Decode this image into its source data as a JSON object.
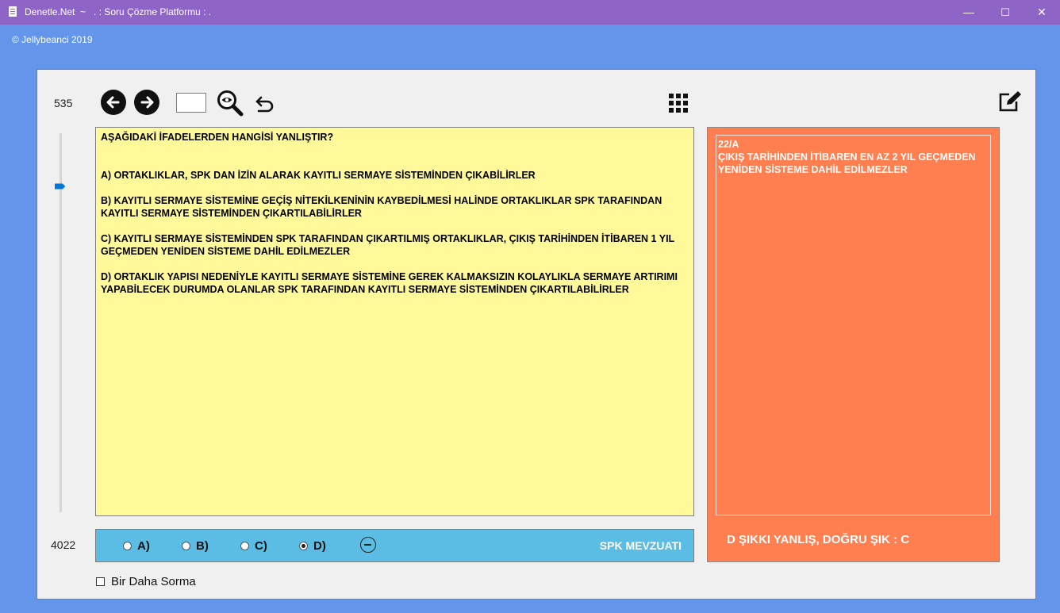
{
  "window": {
    "title": "Denetle.Net  ~   . : Soru Çözme Platformu : .",
    "minimize": "—",
    "maximize": "☐",
    "close": "✕"
  },
  "copyright": "© Jellybeanci 2019",
  "toolbar": {
    "current_number": "535",
    "total_number": "4022",
    "page_input_value": "",
    "icons": [
      "back-arrow-icon",
      "forward-arrow-icon",
      "search-icon",
      "undo-icon",
      "grid-icon",
      "edit-icon"
    ]
  },
  "question": {
    "text": "AŞAĞIDAKİ İFADELERDEN HANGİSİ YANLIŞTIR?",
    "options": {
      "a": "A) ORTAKLIKLAR, SPK DAN İZİN ALARAK KAYITLI SERMAYE SİSTEMİNDEN ÇIKABİLİRLER",
      "b": "B) KAYITLI SERMAYE SİSTEMİNE GEÇİŞ NİTEKİLKENİNİN KAYBEDİLMESİ HALİNDE ORTAKLIKLAR SPK TARAFINDAN KAYITLI SERMAYE SİSTEMİNDEN ÇIKARTILABİLİRLER",
      "c": "C) KAYITLI SERMAYE SİSTEMİNDEN SPK TARAFINDAN ÇIKARTILMIŞ ORTAKLIKLAR, ÇIKIŞ TARİHİNDEN İTİBAREN 1 YIL GEÇMEDEN YENİDEN SİSTEME DAHİL EDİLMEZLER",
      "d": "D) ORTAKLIK YAPISI NEDENİYLE KAYITLI SERMAYE SİSTEMİNE GEREK KALMAKSIZIN KOLAYLIKLA SERMAYE ARTIRIMI YAPABİLECEK DURUMDA OLANLAR SPK TARAFINDAN KAYITLI SERMAYE SİSTEMİNDEN ÇIKARTILABİLİRLER"
    }
  },
  "answer_bar": {
    "options": [
      "A)",
      "B)",
      "C)",
      "D)"
    ],
    "selected": "D)",
    "category": "SPK MEVZUATI"
  },
  "dont_ask_again": "Bir Daha Sorma",
  "answer_panel": {
    "reference": "22/A",
    "explanation": "ÇIKIŞ TARİHİNDEN İTİBAREN EN AZ 2 YIL GEÇMEDEN YENİDEN SİSTEME DAHİL EDİLMEZLER",
    "result": "D ŞIKKI YANLIŞ, DOĞRU ŞIK : C"
  },
  "colors": {
    "titlebar": "#8E65C7",
    "background": "#6395EB",
    "question_bg": "#FFF99A",
    "answer_bar_bg": "#5BBCE4",
    "answer_panel_bg": "#FF7F50",
    "slider_thumb": "#0078D7"
  }
}
